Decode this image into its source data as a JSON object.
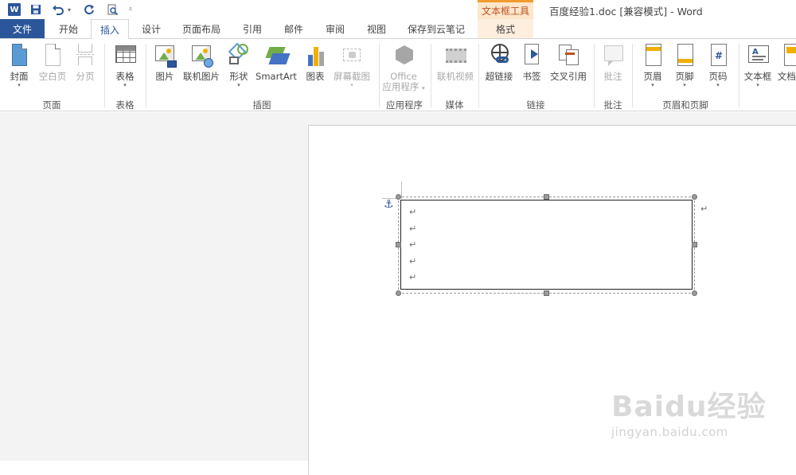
{
  "window": {
    "title": "百度经验1.doc [兼容模式] - Word",
    "context_header": "文本框工具"
  },
  "tabs": {
    "file": "文件",
    "home": "开始",
    "insert": "插入",
    "design": "设计",
    "layout": "页面布局",
    "references": "引用",
    "mailings": "邮件",
    "review": "审阅",
    "view": "视图",
    "cloud": "保存到云笔记",
    "format": "格式"
  },
  "ribbon": {
    "cover": "封面",
    "blank_page": "空白页",
    "page_break": "分页",
    "table": "表格",
    "picture": "图片",
    "online_picture": "联机图片",
    "shapes": "形状",
    "smartart": "SmartArt",
    "chart": "图表",
    "screenshot": "屏幕截图",
    "office_apps_1": "Office",
    "office_apps_2": "应用程序",
    "online_video": "联机视频",
    "hyperlink": "超链接",
    "bookmark": "书签",
    "cross_ref": "交叉引用",
    "comment": "批注",
    "header": "页眉",
    "footer": "页脚",
    "page_number": "页码",
    "textbox": "文本框",
    "doc_parts": "文档部"
  },
  "groups": {
    "pages": "页面",
    "tables": "表格",
    "illustrations": "插图",
    "apps": "应用程序",
    "media": "媒体",
    "links": "链接",
    "comments": "批注",
    "header_footer": "页眉和页脚"
  },
  "document": {
    "paragraph_mark": "↵"
  },
  "watermark": {
    "brand": "Baidu经验",
    "url": "jingyan.baidu.com"
  },
  "colors": {
    "word_blue": "#2b579a",
    "context_orange": "#f19b2d"
  }
}
